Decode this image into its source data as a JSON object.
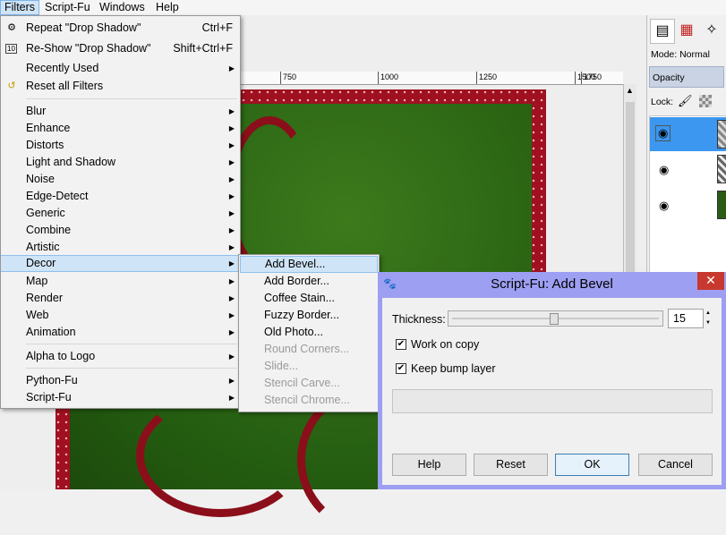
{
  "menubar": {
    "items": [
      "Filters",
      "Script-Fu",
      "Windows",
      "Help"
    ]
  },
  "ruler": {
    "ticks": [
      "750",
      "1000",
      "1250",
      "1500",
      "1750"
    ]
  },
  "filters_menu": {
    "items": [
      {
        "label": "Repeat \"Drop Shadow\"",
        "accel": "Ctrl+F",
        "icon": "repeat-icon"
      },
      {
        "label": "Re-Show \"Drop Shadow\"",
        "accel": "Shift+Ctrl+F",
        "icon": "reshow-icon"
      },
      {
        "label": "Recently Used",
        "submenu": true
      },
      {
        "label": "Reset all Filters",
        "icon": "reset-filters-icon"
      },
      {
        "label": "Blur",
        "submenu": true
      },
      {
        "label": "Enhance",
        "submenu": true
      },
      {
        "label": "Distorts",
        "submenu": true
      },
      {
        "label": "Light and Shadow",
        "submenu": true
      },
      {
        "label": "Noise",
        "submenu": true
      },
      {
        "label": "Edge-Detect",
        "submenu": true
      },
      {
        "label": "Generic",
        "submenu": true
      },
      {
        "label": "Combine",
        "submenu": true
      },
      {
        "label": "Artistic",
        "submenu": true
      },
      {
        "label": "Decor",
        "submenu": true,
        "highlighted": true
      },
      {
        "label": "Map",
        "submenu": true
      },
      {
        "label": "Render",
        "submenu": true
      },
      {
        "label": "Web",
        "submenu": true
      },
      {
        "label": "Animation",
        "submenu": true
      },
      {
        "label": "Alpha to Logo",
        "submenu": true
      },
      {
        "label": "Python-Fu",
        "submenu": true
      },
      {
        "label": "Script-Fu",
        "submenu": true
      }
    ]
  },
  "decor_menu": {
    "items": [
      {
        "label": "Add Bevel...",
        "highlighted": true
      },
      {
        "label": "Add Border..."
      },
      {
        "label": "Coffee Stain..."
      },
      {
        "label": "Fuzzy Border..."
      },
      {
        "label": "Old Photo..."
      },
      {
        "label": "Round Corners...",
        "disabled": true
      },
      {
        "label": "Slide...",
        "disabled": true
      },
      {
        "label": "Stencil Carve...",
        "disabled": true
      },
      {
        "label": "Stencil Chrome...",
        "disabled": true
      }
    ]
  },
  "layers_panel": {
    "mode_label": "Mode: Normal",
    "opacity_label": "Opacity",
    "lock_label": "Lock:"
  },
  "dialog": {
    "title": "Script-Fu: Add Bevel",
    "close": "✕",
    "thickness_label": "Thickness:",
    "thickness_value": "15",
    "work_on_copy_label": "Work on copy",
    "work_on_copy_checked": true,
    "keep_bump_label": "Keep bump layer",
    "keep_bump_checked": true,
    "buttons": {
      "help": "Help",
      "reset": "Reset",
      "ok": "OK",
      "cancel": "Cancel"
    }
  },
  "colors": {
    "menu_highlight": "#cfe4f7",
    "dialog_frame": "#9d9ff2",
    "close_button": "#c7392f",
    "glitter_red": "#a01020",
    "grass_green": "#2f6a15"
  }
}
